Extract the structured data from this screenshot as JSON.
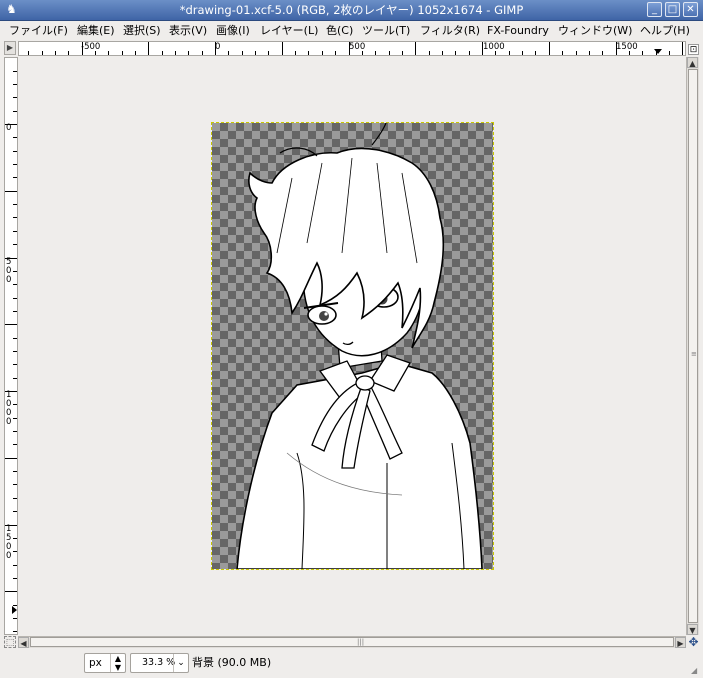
{
  "window": {
    "title": "*drawing-01.xcf-5.0 (RGB, 2枚のレイヤー) 1052x1674 - GIMP",
    "app_icon": "gimp-wilber-icon",
    "buttons": {
      "minimize": "_",
      "maximize": "□",
      "close": "✕"
    }
  },
  "menu": [
    "ファイル(F)",
    "編集(E)",
    "選択(S)",
    "表示(V)",
    "画像(I)",
    "レイヤー(L)",
    "色(C)",
    "ツール(T)",
    "フィルタ(R)",
    "FX-Foundry",
    "ウィンドウ(W)",
    "ヘルプ(H)"
  ],
  "rulers": {
    "horizontal_labels": [
      "-500",
      "0",
      "500",
      "1000",
      "1500"
    ],
    "vertical_labels": [
      "0",
      "500",
      "1000",
      "1500"
    ]
  },
  "status": {
    "unit": "px",
    "zoom": "33.3 %",
    "layer_info": "背景 (90.0 MB)"
  },
  "colors": {
    "titlebar": "#4a6fb0",
    "selection_outline": "#c8c800",
    "checker_dark": "#666666",
    "checker_light": "#9a9a9a"
  }
}
